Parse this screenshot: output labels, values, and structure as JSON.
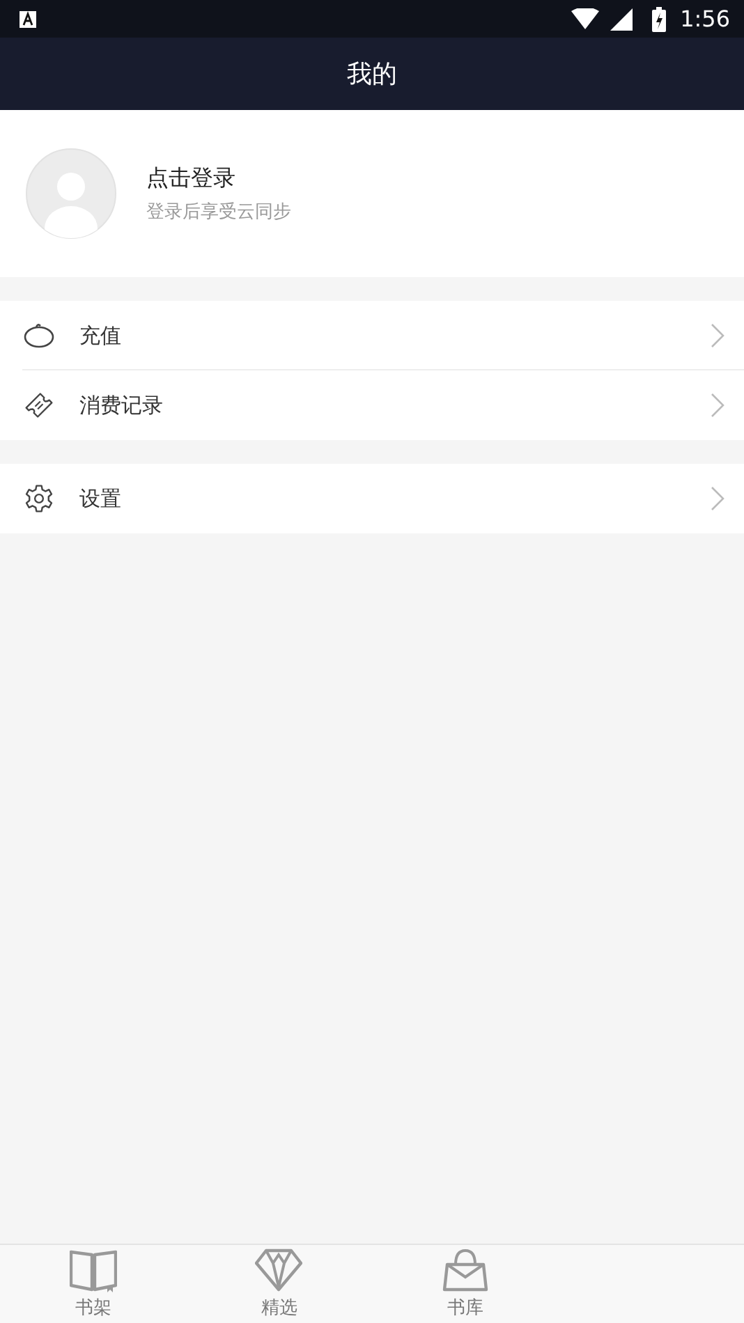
{
  "status_bar": {
    "time": "1:56"
  },
  "header": {
    "title": "我的"
  },
  "profile": {
    "name": "点击登录",
    "subtitle": "登录后享受云同步"
  },
  "menu_groups": [
    {
      "items": [
        {
          "kind": "recharge",
          "label": "充值"
        },
        {
          "kind": "history",
          "label": "消费记录"
        }
      ]
    },
    {
      "items": [
        {
          "kind": "settings",
          "label": "设置"
        }
      ]
    }
  ],
  "tab_bar": [
    {
      "kind": "shelf",
      "label": "书架"
    },
    {
      "kind": "featured",
      "label": "精选"
    },
    {
      "kind": "store",
      "label": "书库"
    }
  ]
}
